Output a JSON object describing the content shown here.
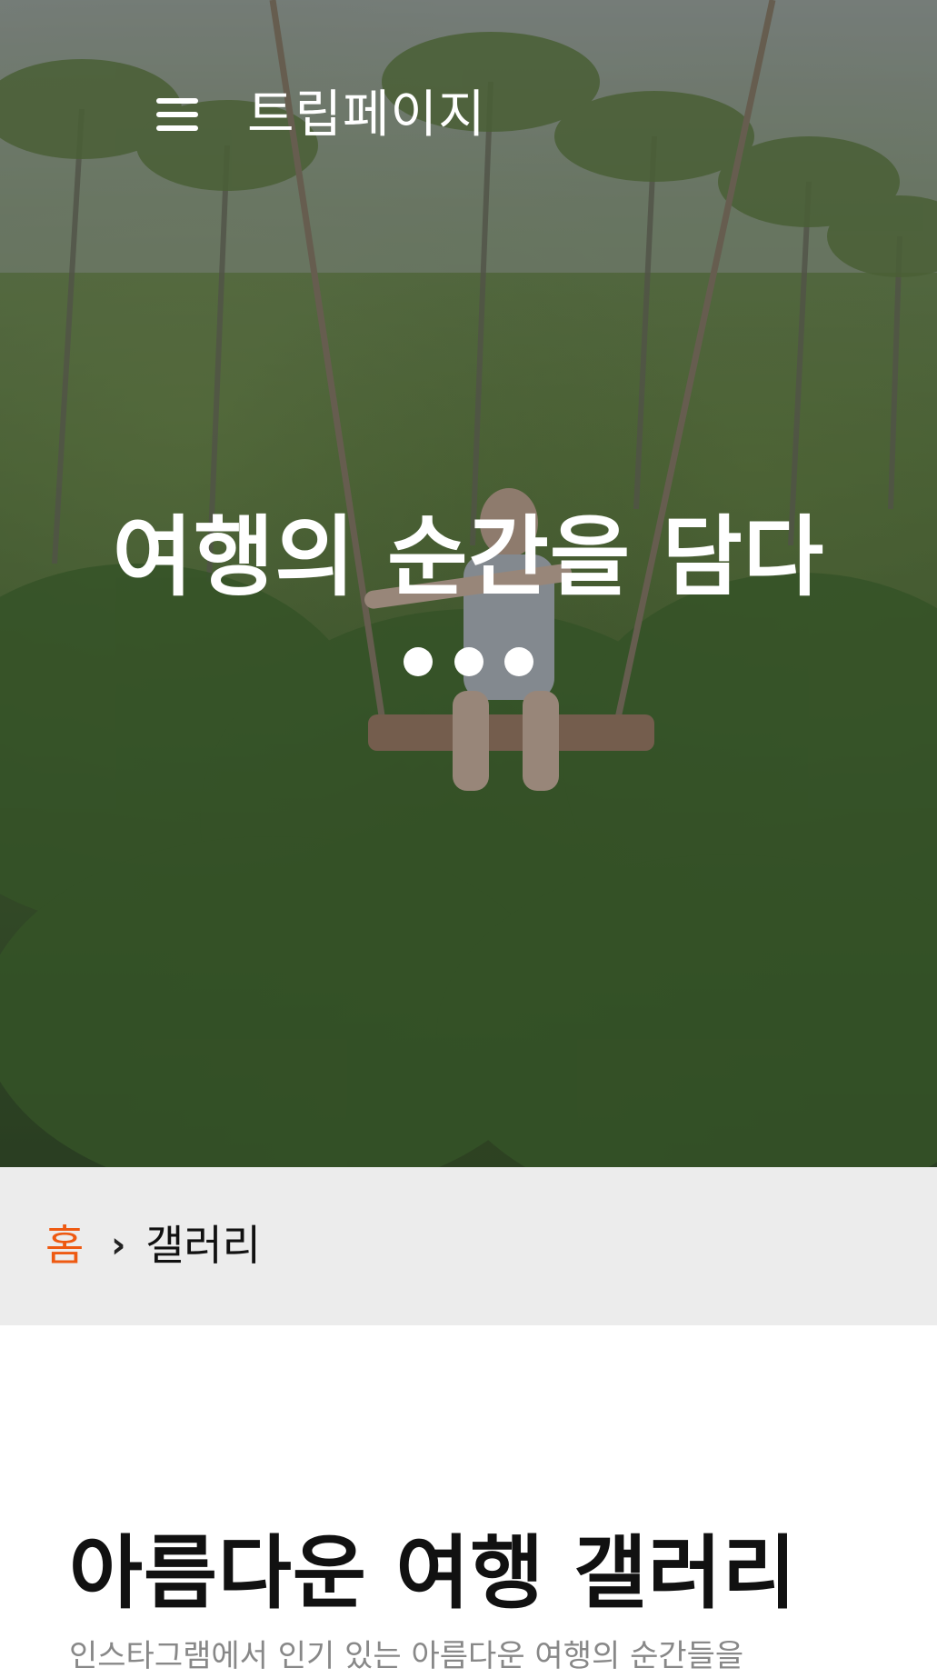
{
  "header": {
    "menu_icon": "hamburger-menu-icon",
    "site_title": "트립페이지"
  },
  "hero": {
    "title": "여행의 순간을 담다",
    "slide_count": 3
  },
  "breadcrumb": {
    "home": "홈",
    "separator": "›",
    "current": "갤러리"
  },
  "gallery": {
    "title": "아름다운 여행 갤러리",
    "description": "인스타그램에서 인기 있는 아름다운 여행의 순간들을"
  },
  "colors": {
    "accent": "#ee5a12",
    "breadcrumb_bg": "#ececec",
    "hero_text": "#ffffff",
    "body_text": "#111111",
    "muted_text": "#888888"
  }
}
